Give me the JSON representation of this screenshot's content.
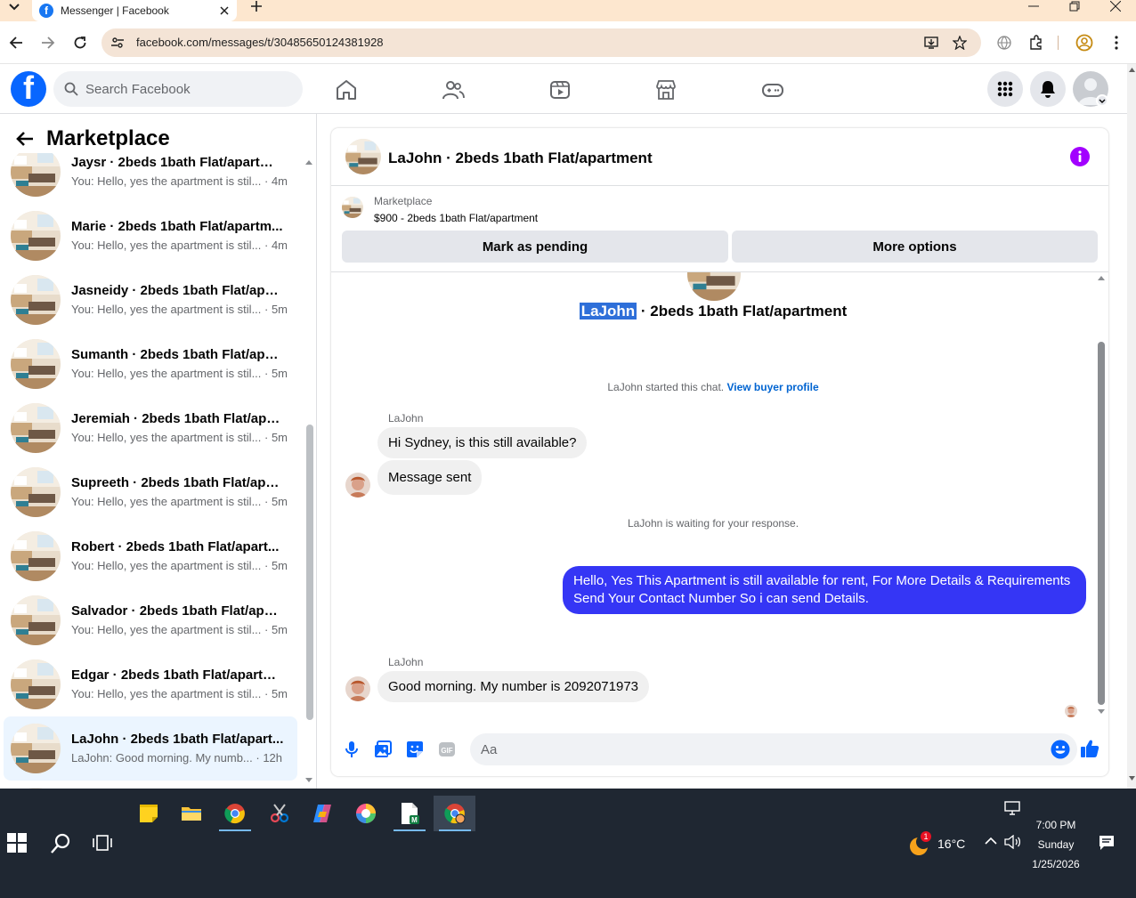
{
  "browser": {
    "tab_title": "Messenger | Facebook",
    "tab_favicon": "f",
    "url": "facebook.com/messages/t/30485650124381928"
  },
  "fb": {
    "logo": "f",
    "search_placeholder": "Search Facebook",
    "accent": "#0866ff"
  },
  "sidebar": {
    "title": "Marketplace",
    "conversations": [
      {
        "name": "Jaysr · 2beds 1bath Flat/apartment",
        "preview": "You: Hello, yes the apartment is stil... · 4m"
      },
      {
        "name": "Marie · 2beds 1bath Flat/apartm...",
        "preview": "You: Hello, yes the apartment is stil... · 4m"
      },
      {
        "name": "Jasneidy · 2beds 1bath Flat/apar...",
        "preview": "You: Hello, yes the apartment is stil... · 5m"
      },
      {
        "name": "Sumanth · 2beds 1bath Flat/apar...",
        "preview": "You: Hello, yes the apartment is stil... · 5m"
      },
      {
        "name": "Jeremiah · 2beds 1bath Flat/apar...",
        "preview": "You: Hello, yes the apartment is stil... · 5m"
      },
      {
        "name": "Supreeth · 2beds 1bath Flat/apar...",
        "preview": "You: Hello, yes the apartment is stil... · 5m"
      },
      {
        "name": "Robert · 2beds 1bath Flat/apart...",
        "preview": "You: Hello, yes the apartment is stil... · 5m"
      },
      {
        "name": "Salvador · 2beds 1bath Flat/apar...",
        "preview": "You: Hello, yes the apartment is stil... · 5m"
      },
      {
        "name": "Edgar · 2beds 1bath Flat/apartm...",
        "preview": "You: Hello, yes the apartment is stil... · 5m"
      },
      {
        "name": "LaJohn · 2beds 1bath Flat/apart...",
        "preview": "LaJohn: Good morning. My numb... · 12h"
      }
    ]
  },
  "chat": {
    "title": "LaJohn · 2beds 1bath Flat/apartment",
    "marketplace_label": "Marketplace",
    "listing": "$900 - 2beds 1bath Flat/apartment",
    "mark_pending": "Mark as pending",
    "more_options": "More options",
    "big_title_name": "LaJohn",
    "big_title_rest": " · 2beds 1bath Flat/apartment",
    "started_text": "LaJohn started this chat. ",
    "buyer_profile_link": "View buyer profile",
    "sender_name": "LaJohn",
    "msg1": "Hi Sydney, is this still available?",
    "msg2": "Message sent",
    "waiting_text": "LaJohn is waiting for your response.",
    "reply": "Hello, Yes This Apartment is still available for rent, For More Details & Requirements Send Your Contact Number So i can send Details.",
    "sender_name2": "LaJohn",
    "msg3": "Good morning. My number is 2092071973",
    "composer_placeholder": "Aa",
    "outgoing_color": "#3536f5"
  },
  "taskbar": {
    "temperature": "16°C",
    "weather_badge": "1",
    "time": "7:00 PM",
    "day": "Sunday",
    "date": "1/25/2026"
  }
}
